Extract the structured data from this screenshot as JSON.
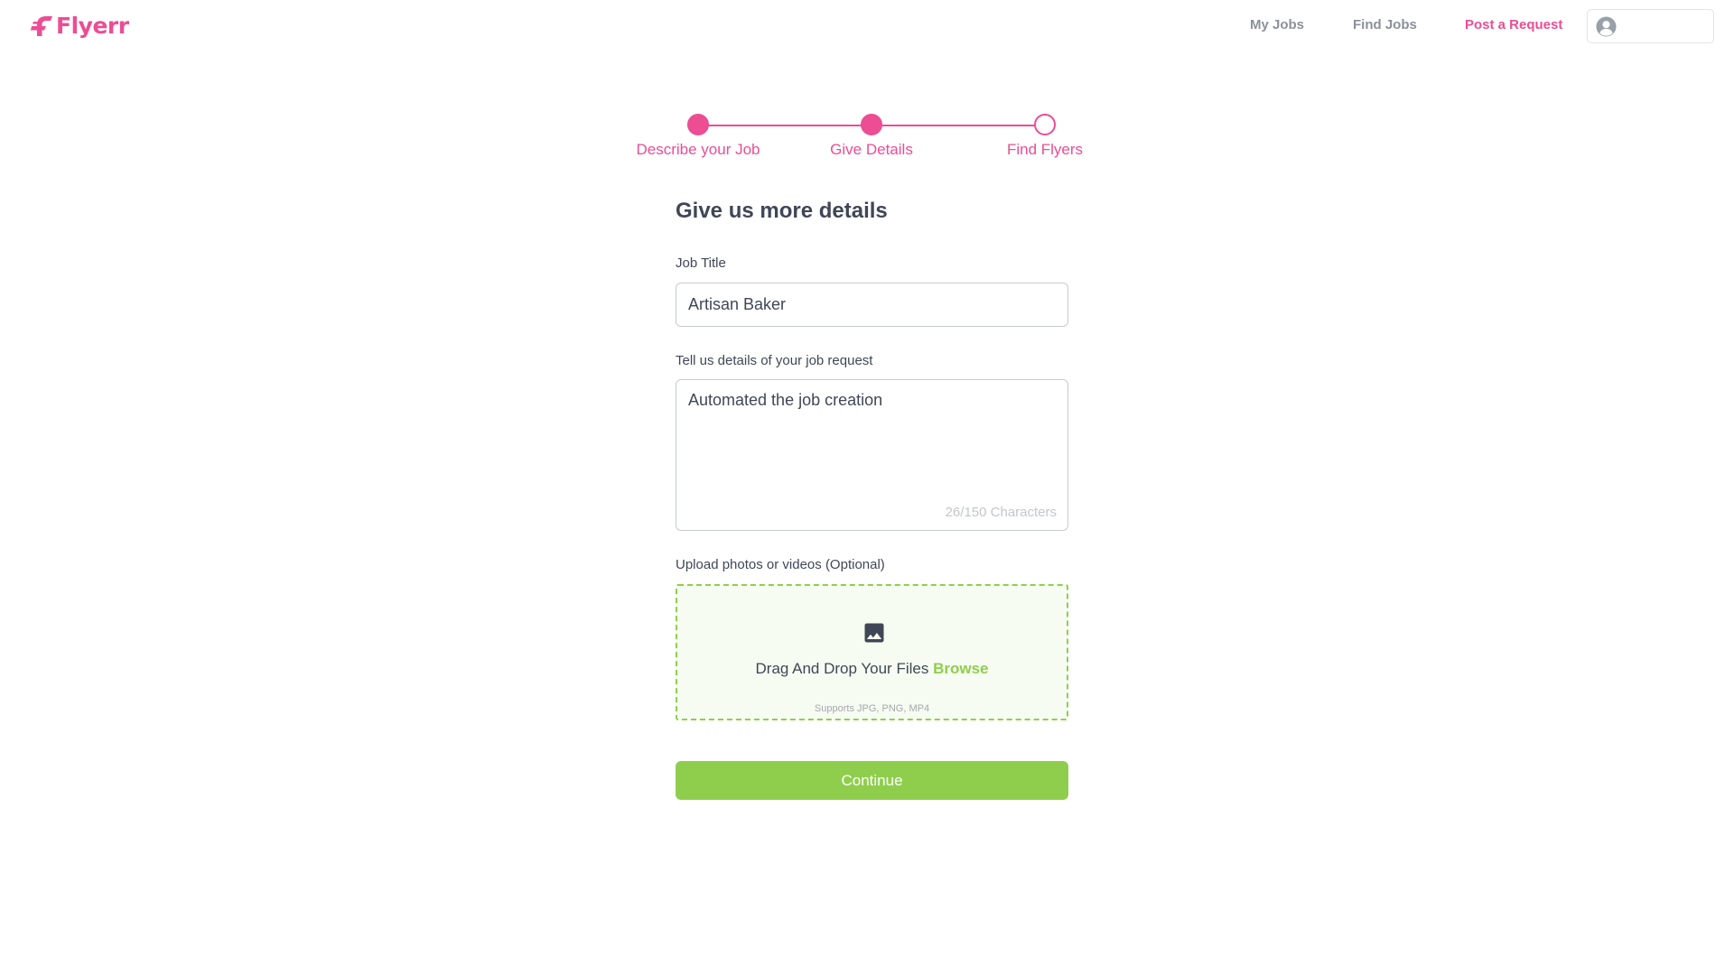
{
  "header": {
    "logo_text": "Flyerr",
    "nav": {
      "my_jobs": "My Jobs",
      "find_jobs": "Find Jobs",
      "post_request": "Post a Request"
    },
    "avatar_icon": "user-avatar-icon"
  },
  "stepper": {
    "steps": [
      {
        "label": "Describe your Job",
        "state": "complete"
      },
      {
        "label": "Give Details",
        "state": "current"
      },
      {
        "label": "Find Flyers",
        "state": "pending"
      }
    ]
  },
  "form": {
    "title": "Give us more details",
    "job_title_label": "Job Title",
    "job_title_value": "Artisan Baker",
    "details_label": "Tell us details of your job request",
    "details_value": "Automated the job creation",
    "char_count": "26/150 Characters",
    "upload_label": "Upload photos or videos (Optional)",
    "upload": {
      "icon": "image-icon",
      "drag_text": "Drag And Drop Your Files",
      "browse_text": "Browse",
      "supports_text": "Supports JPG, PNG, MP4"
    },
    "continue_label": "Continue"
  },
  "colors": {
    "brand": "#ec4d93",
    "accent_green": "#8fce4d",
    "nav_gray": "#8b9099",
    "text_dark": "#3f4756"
  }
}
